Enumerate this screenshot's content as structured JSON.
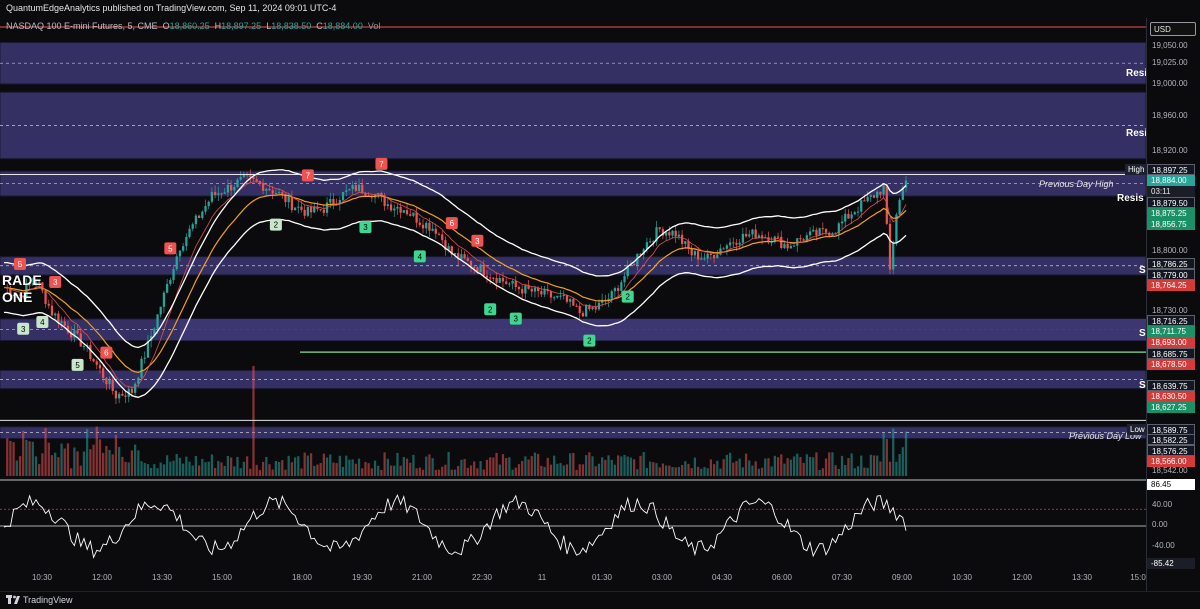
{
  "header": {
    "publisher_line": "QuantumEdgeAnalytics published on TradingView.com, Sep 11, 2024 09:01 UTC-4",
    "symbol": "NASDAQ 100 E-mini Futures, 5, CME",
    "o_label": "O",
    "o_value": "18,860.25",
    "h_label": "H",
    "h_value": "18,897.25",
    "l_label": "L",
    "l_value": "18,838.50",
    "c_label": "C",
    "c_value": "18,884.00",
    "vol_label": "Vol"
  },
  "footer": {
    "brand": "TradingView"
  },
  "currency": "USD",
  "annotations": {
    "previous_day_high": "Previous Day High",
    "previous_day_low": "Previous Day Low",
    "high_tag": "High",
    "low_tag": "Low",
    "countdown": "03:11",
    "trade_text_1": "RADE",
    "trade_text_2": "ONE",
    "zone_labels": [
      "Resi",
      "Resi",
      "Resis",
      "S",
      "S",
      "S"
    ]
  },
  "colors": {
    "up": "#26a69a",
    "down": "#ef5350",
    "zone_fill": "#3d3773",
    "bollinger": "#ffffff",
    "ema": "#f0a020",
    "mid_ema": "#e05050",
    "oscillator": "#ffffff",
    "signal_green": "#3fd68f",
    "pd_line": "#e6e6e6",
    "level_line_green": "#80e0a0"
  },
  "chart_data": [
    {
      "type": "candlestick",
      "symbol": "NASDAQ 100 E-mini Futures",
      "timeframe": "5",
      "x_ticks": [
        "10:30",
        "12:00",
        "13:30",
        "15:00",
        "18:00",
        "19:30",
        "21:00",
        "22:30",
        "11",
        "01:30",
        "03:00",
        "04:30",
        "06:00",
        "07:30",
        "09:00",
        "10:30",
        "12:00",
        "13:30",
        "15:0"
      ],
      "y_ticks": [
        "19,050.00",
        "19,025.00",
        "19,000.00",
        "18,960.00",
        "18,920.00",
        "18,800.00",
        "18,730.00",
        "18,542.00"
      ],
      "ylim": [
        18530,
        19060
      ],
      "close_path": [
        [
          0,
          18750
        ],
        [
          5,
          18740
        ],
        [
          10,
          18760
        ],
        [
          15,
          18720
        ],
        [
          20,
          18700
        ],
        [
          25,
          18680
        ],
        [
          30,
          18650
        ],
        [
          35,
          18620
        ],
        [
          40,
          18625
        ],
        [
          45,
          18680
        ],
        [
          50,
          18740
        ],
        [
          55,
          18800
        ],
        [
          60,
          18830
        ],
        [
          65,
          18860
        ],
        [
          70,
          18870
        ],
        [
          75,
          18880
        ],
        [
          80,
          18875
        ],
        [
          85,
          18865
        ],
        [
          90,
          18850
        ],
        [
          95,
          18840
        ],
        [
          100,
          18845
        ],
        [
          105,
          18860
        ],
        [
          110,
          18870
        ],
        [
          115,
          18865
        ],
        [
          120,
          18850
        ],
        [
          125,
          18845
        ],
        [
          130,
          18830
        ],
        [
          135,
          18820
        ],
        [
          140,
          18790
        ],
        [
          145,
          18780
        ],
        [
          150,
          18770
        ],
        [
          155,
          18760
        ],
        [
          160,
          18750
        ],
        [
          165,
          18745
        ],
        [
          170,
          18740
        ],
        [
          175,
          18735
        ],
        [
          180,
          18720
        ],
        [
          185,
          18725
        ],
        [
          190,
          18740
        ],
        [
          195,
          18770
        ],
        [
          200,
          18800
        ],
        [
          205,
          18820
        ],
        [
          210,
          18815
        ],
        [
          215,
          18790
        ],
        [
          220,
          18785
        ],
        [
          225,
          18800
        ],
        [
          230,
          18810
        ],
        [
          235,
          18815
        ],
        [
          240,
          18810
        ],
        [
          245,
          18800
        ],
        [
          250,
          18810
        ],
        [
          255,
          18815
        ],
        [
          260,
          18820
        ],
        [
          265,
          18840
        ],
        [
          270,
          18855
        ],
        [
          275,
          18870
        ],
        [
          277,
          18770
        ],
        [
          279,
          18840
        ],
        [
          282,
          18884
        ]
      ],
      "price_labels": [
        {
          "value": "18,897.25",
          "kind": "high"
        },
        {
          "value": "18,884.00",
          "kind": "last"
        },
        {
          "value": "18,879.50",
          "kind": "neutral"
        },
        {
          "value": "18,875.25",
          "kind": "up"
        },
        {
          "value": "18,856.75",
          "kind": "up"
        },
        {
          "value": "18,786.25",
          "kind": "neutral"
        },
        {
          "value": "18,779.00",
          "kind": "neutral"
        },
        {
          "value": "18,764.25",
          "kind": "down"
        },
        {
          "value": "18,716.25",
          "kind": "neutral"
        },
        {
          "value": "18,711.75",
          "kind": "up"
        },
        {
          "value": "18,693.00",
          "kind": "down"
        },
        {
          "value": "18,685.75",
          "kind": "neutral"
        },
        {
          "value": "18,678.50",
          "kind": "down"
        },
        {
          "value": "18,639.75",
          "kind": "neutral"
        },
        {
          "value": "18,630.50",
          "kind": "down"
        },
        {
          "value": "18,627.25",
          "kind": "up"
        },
        {
          "value": "18,589.75",
          "kind": "low"
        },
        {
          "value": "18,582.25",
          "kind": "neutral"
        },
        {
          "value": "18,576.25",
          "kind": "neutral"
        },
        {
          "value": "18,566.00",
          "kind": "down"
        }
      ],
      "signals": [
        {
          "label": "5",
          "dir": "down",
          "bar": 5
        },
        {
          "label": "3",
          "dir": "down",
          "bar": 16
        },
        {
          "label": "6",
          "dir": "down",
          "bar": 32
        },
        {
          "label": "5",
          "dir": "down",
          "bar": 52
        },
        {
          "label": "7",
          "dir": "down",
          "bar": 95
        },
        {
          "label": "7",
          "dir": "down",
          "bar": 118
        },
        {
          "label": "6",
          "dir": "down",
          "bar": 140
        },
        {
          "label": "3",
          "dir": "down",
          "bar": 148
        },
        {
          "label": "3",
          "dir": "up",
          "bar": 6
        },
        {
          "label": "4",
          "dir": "up",
          "bar": 12
        },
        {
          "label": "5",
          "dir": "up",
          "bar": 23
        },
        {
          "label": "2",
          "dir": "up",
          "bar": 85
        },
        {
          "label": "3",
          "dir": "up",
          "bar": 113
        },
        {
          "label": "4",
          "dir": "up",
          "bar": 130
        },
        {
          "label": "2",
          "dir": "up",
          "bar": 152
        },
        {
          "label": "3",
          "dir": "up",
          "bar": 160
        },
        {
          "label": "2",
          "dir": "up",
          "bar": 183
        },
        {
          "label": "2",
          "dir": "up",
          "bar": 195
        }
      ]
    },
    {
      "type": "line",
      "name": "oscillator",
      "y_ticks": [
        "86.45",
        "40.00",
        "0.00",
        "-40.00",
        "-85.42"
      ],
      "ylim": [
        -100,
        100
      ]
    }
  ]
}
